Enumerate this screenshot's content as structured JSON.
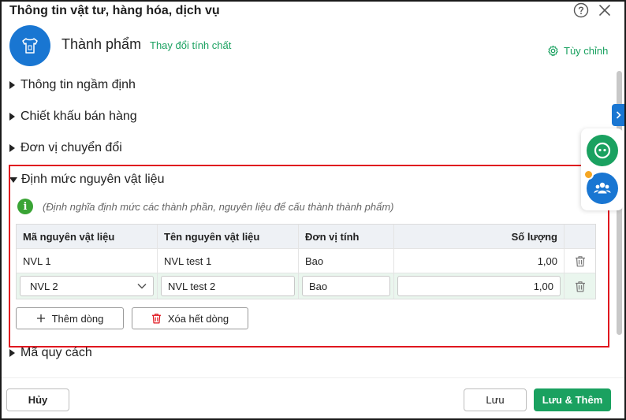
{
  "dialog": {
    "title": "Thông tin vật tư, hàng hóa, dịch vụ"
  },
  "product": {
    "type_name": "Thành phẩm",
    "change_link": "Thay đổi tính chất",
    "customize_label": "Tùy chỉnh"
  },
  "sections": {
    "default_info": "Thông tin ngầm định",
    "sales_discount": "Chiết khấu bán hàng",
    "unit_conversion": "Đơn vị chuyển đổi",
    "material_norm": "Định mức nguyên vật liệu",
    "spec_code": "Mã quy cách"
  },
  "material_norm": {
    "info_text": "(Định nghĩa định mức các thành phần, nguyên liệu để cấu thành thành phẩm)",
    "columns": [
      "Mã nguyên vật liệu",
      "Tên nguyên vật liệu",
      "Đơn vị tính",
      "Số lượng"
    ],
    "rows": [
      {
        "code": "NVL 1",
        "name": "NVL test 1",
        "unit": "Bao",
        "qty": "1,00"
      },
      {
        "code": "NVL 2",
        "name": "NVL test 2",
        "unit": "Bao",
        "qty": "1,00"
      }
    ],
    "add_row_label": "Thêm dòng",
    "delete_all_label": "Xóa hết dòng"
  },
  "footer": {
    "cancel_label": "Hủy",
    "save_label": "Lưu",
    "save_add_label": "Lưu & Thêm"
  },
  "colors": {
    "accent_green": "#1aa160",
    "primary_blue": "#1976d2",
    "highlight_red": "#e0161f"
  }
}
